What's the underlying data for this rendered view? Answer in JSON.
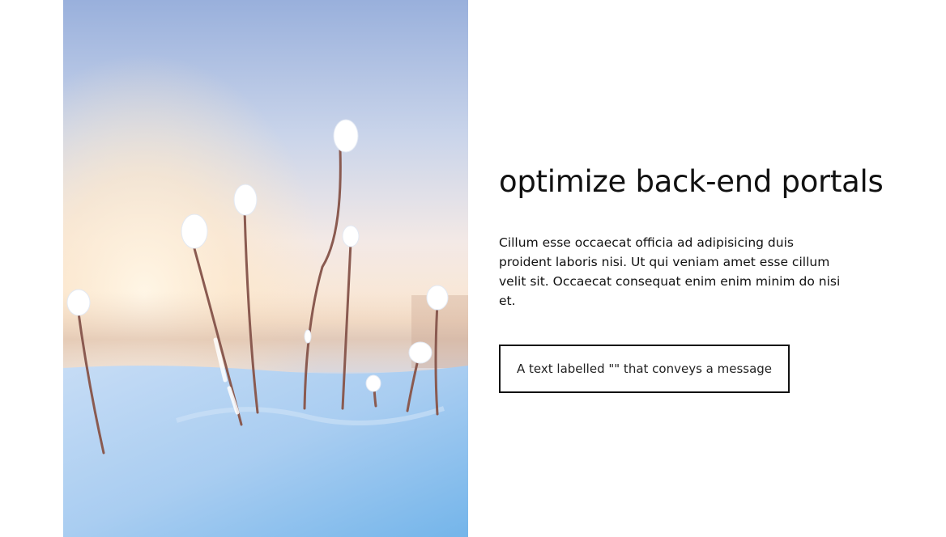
{
  "hero": {
    "image_description_icon": "snow-covered-plants-photo",
    "colors": {
      "sky_top": "#9fb7e0",
      "sky_glow": "#fff3e0",
      "snow": "#a8cdf2",
      "snow_deep": "#7cb7ea"
    }
  },
  "content": {
    "title": "optimize back-end portals",
    "body": "Cillum esse occaecat officia ad adipisicing duis proident laboris nisi. Ut qui veniam amet esse cillum velit sit. Occaecat consequat enim enim minim do nisi et.",
    "cta_label": "A text labelled \"\" that conveys a message"
  }
}
